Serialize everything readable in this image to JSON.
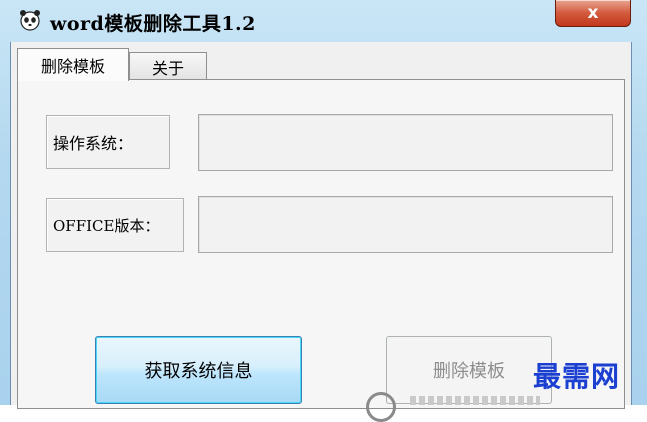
{
  "window": {
    "title": "word模板删除工具1.2",
    "close_symbol": "x"
  },
  "tabs": [
    {
      "label": "删除模板",
      "active": true
    },
    {
      "label": "关于",
      "active": false
    }
  ],
  "fields": {
    "os_label": "操作系统：",
    "os_value": "",
    "office_label": "OFFICE版本：",
    "office_value": ""
  },
  "buttons": {
    "get_info": "获取系统信息",
    "delete_template": "删除模板"
  },
  "watermark": "最需网",
  "colors": {
    "title_bg": "#b4d8ef",
    "close_red": "#d35a3d",
    "primary_border": "#3c7fb1",
    "watermark_blue": "#1a3fd1"
  }
}
